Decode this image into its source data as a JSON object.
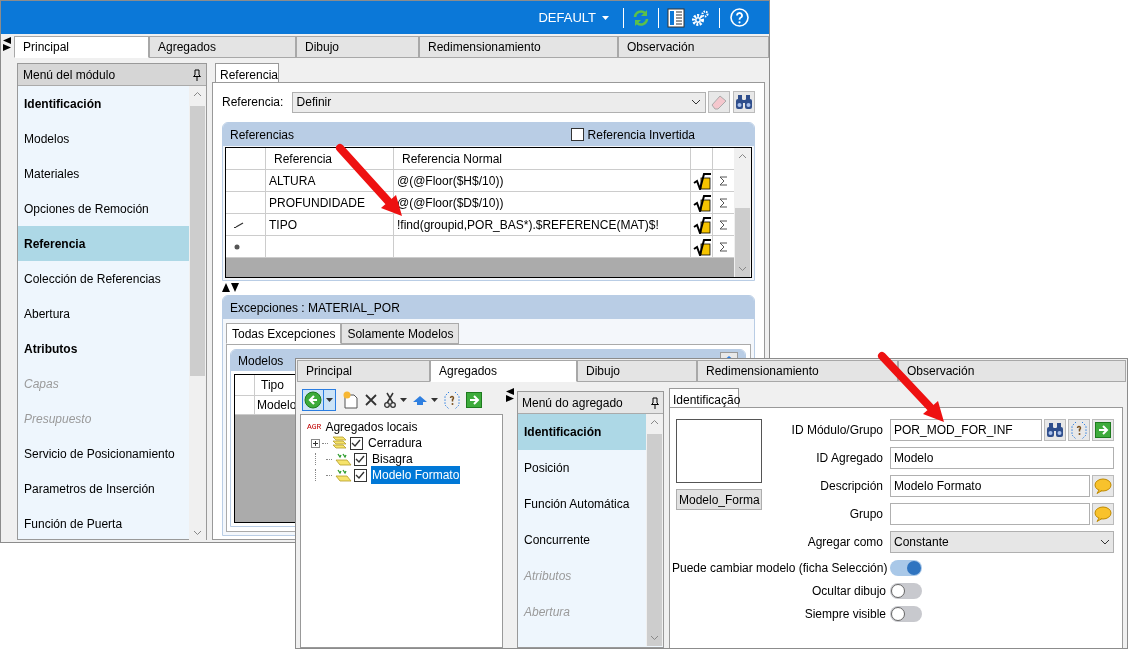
{
  "main_window": {
    "header": {
      "profile": "DEFAULT"
    },
    "tabs": [
      {
        "label": "Principal",
        "selected": true
      },
      {
        "label": "Agregados",
        "selected": false
      },
      {
        "label": "Dibujo",
        "selected": false
      },
      {
        "label": "Redimensionamiento",
        "selected": false
      },
      {
        "label": "Observación",
        "selected": false
      }
    ],
    "module_menu": {
      "title": "Menú del módulo",
      "items": [
        {
          "label": "Identificación",
          "kind": "heading",
          "selected": false,
          "disabled": false
        },
        {
          "label": "Modelos",
          "kind": "item",
          "selected": false,
          "disabled": false
        },
        {
          "label": "Materiales",
          "kind": "item",
          "selected": false,
          "disabled": false
        },
        {
          "label": "Opciones de Remoción",
          "kind": "item",
          "selected": false,
          "disabled": false
        },
        {
          "label": "Referencia",
          "kind": "item",
          "selected": true,
          "disabled": false
        },
        {
          "label": "Colección de Referencias",
          "kind": "item",
          "selected": false,
          "disabled": false
        },
        {
          "label": "Abertura",
          "kind": "item",
          "selected": false,
          "disabled": false
        },
        {
          "label": "Atributos",
          "kind": "heading",
          "selected": false,
          "disabled": false
        },
        {
          "label": "Capas",
          "kind": "item",
          "selected": false,
          "disabled": true
        },
        {
          "label": "Presupuesto",
          "kind": "item",
          "selected": false,
          "disabled": true
        },
        {
          "label": "Servicio de Posicionamiento",
          "kind": "item",
          "selected": false,
          "disabled": false
        },
        {
          "label": "Parametros de Inserción",
          "kind": "item",
          "selected": false,
          "disabled": false
        },
        {
          "label": "Función de Puerta",
          "kind": "item",
          "selected": false,
          "disabled": false
        }
      ]
    },
    "content_tab": "Referencia",
    "reference_field": {
      "label": "Referencia:",
      "value": "Definir"
    },
    "referencias": {
      "title": "Referencias",
      "inverted": {
        "label": "Referencia Invertida",
        "checked": false
      },
      "columns": [
        "Referencia",
        "Referencia Normal"
      ],
      "rows": [
        {
          "kind": "none",
          "referencia": "ALTURA",
          "normal": "@(@Floor($H$/10))"
        },
        {
          "kind": "none",
          "referencia": "PROFUNDIDADE",
          "normal": "@(@Floor($D$/10))"
        },
        {
          "kind": "edit",
          "referencia": "TIPO",
          "normal": "!find(groupid,POR_BAS*).$REFERENCE(MAT)$!"
        },
        {
          "kind": "new"
        }
      ]
    },
    "exceptions": {
      "title": "Excepciones : MATERIAL_POR",
      "tabs": [
        {
          "label": "Todas Excepciones",
          "selected": true
        },
        {
          "label": "Solamente Modelos",
          "selected": false
        }
      ],
      "models": {
        "title": "Modelos",
        "columns": [
          "Tipo"
        ],
        "rows": [
          "Modelo"
        ]
      }
    }
  },
  "overlay_window": {
    "tabs": [
      {
        "label": "Principal",
        "selected": false
      },
      {
        "label": "Agregados",
        "selected": true
      },
      {
        "label": "Dibujo",
        "selected": false
      },
      {
        "label": "Redimensionamiento",
        "selected": false
      },
      {
        "label": "Observación",
        "selected": false
      }
    ],
    "tree": {
      "badge": "AGR",
      "label": "Agregados locais",
      "children": [
        {
          "label": "Cerradura",
          "kind": "group",
          "has_children": true,
          "checked": true,
          "selected": false
        },
        {
          "label": "Bisagra",
          "kind": "item",
          "has_children": false,
          "checked": true,
          "selected": false
        },
        {
          "label": "Modelo Formato",
          "kind": "item",
          "has_children": false,
          "checked": true,
          "selected": true
        }
      ]
    },
    "aggregate_menu": {
      "title": "Menú do agregado",
      "items": [
        {
          "label": "Identificación",
          "kind": "heading",
          "selected": true,
          "disabled": false
        },
        {
          "label": "Posición",
          "kind": "item",
          "selected": false,
          "disabled": false
        },
        {
          "label": "Función Automática",
          "kind": "item",
          "selected": false,
          "disabled": false
        },
        {
          "label": "Concurrente",
          "kind": "item",
          "selected": false,
          "disabled": false
        },
        {
          "label": "Atributos",
          "kind": "item",
          "selected": false,
          "disabled": true
        },
        {
          "label": "Abertura",
          "kind": "item",
          "selected": false,
          "disabled": true
        }
      ]
    },
    "content_tab": "Identificação",
    "image_button": "Modelo_Forma",
    "fields": [
      {
        "label": "ID Módulo/Grupo",
        "value": "POR_MOD_FOR_INF",
        "kind": "lookup"
      },
      {
        "label": "ID Agregado",
        "value": "Modelo",
        "kind": "text"
      },
      {
        "label": "Descripción",
        "value": "Modelo Formato",
        "kind": "translatable"
      },
      {
        "label": "Grupo",
        "kind": "translatable"
      },
      {
        "label": "Agregar como",
        "value": "Constante",
        "kind": "select"
      }
    ],
    "toggles": [
      {
        "label": "Puede cambiar modelo (ficha Selección)",
        "on": true
      },
      {
        "label": "Ocultar dibujo",
        "on": false
      },
      {
        "label": "Siempre visible",
        "on": false
      }
    ]
  }
}
